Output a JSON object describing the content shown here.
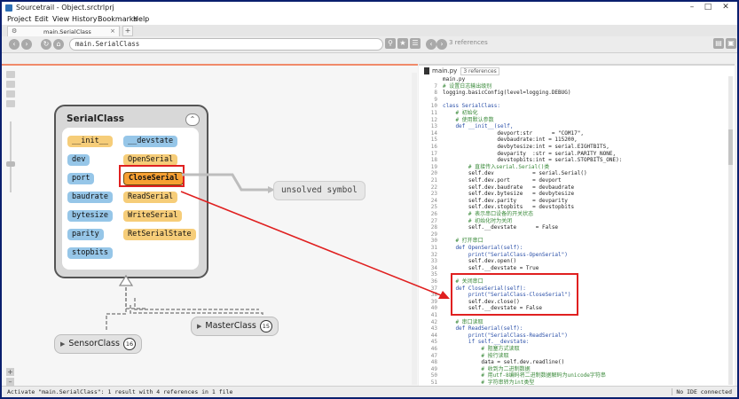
{
  "window": {
    "title": "Sourcetrail - Object.srctrlprj",
    "minimize": "–",
    "maximize": "□",
    "close": "✕"
  },
  "menu": [
    "Project",
    "Edit",
    "View",
    "History",
    "Bookmarks",
    "Help"
  ],
  "tab": {
    "label": "main.SerialClass",
    "close": "×",
    "add": "+"
  },
  "search": {
    "value": "main.SerialClass"
  },
  "code_toolbar": {
    "refs": "3 references"
  },
  "graph": {
    "class_name": "SerialClass",
    "members": [
      {
        "text": "__init__",
        "kind": "fn"
      },
      {
        "text": "__devstate",
        "kind": "var"
      },
      {
        "text": "dev",
        "kind": "var"
      },
      {
        "text": "OpenSerial",
        "kind": "fn"
      },
      {
        "text": "port",
        "kind": "var"
      },
      {
        "text": "CloseSerial",
        "kind": "fn"
      },
      {
        "text": "baudrate",
        "kind": "var"
      },
      {
        "text": "ReadSerial",
        "kind": "fn"
      },
      {
        "text": "bytesize",
        "kind": "var"
      },
      {
        "text": "WriteSerial",
        "kind": "fn"
      },
      {
        "text": "parity",
        "kind": "var"
      },
      {
        "text": "RetSerialState",
        "kind": "fn"
      },
      {
        "text": "stopbits",
        "kind": "var"
      }
    ],
    "unsolved": "unsolved symbol",
    "subclasses": [
      {
        "name": "SensorClass",
        "count": "16"
      },
      {
        "name": "MasterClass",
        "count": "15"
      }
    ],
    "colors": {
      "function": "#f6cd79",
      "variable": "#96c6e8",
      "selected": "#f6a033",
      "highlight": "#e02020"
    }
  },
  "code": {
    "file": "main.py",
    "refs_badge": "3 references",
    "lines": [
      {
        "n": "",
        "t": "main.py"
      },
      {
        "n": "7",
        "t": "# 设置日志输出级别",
        "c": "cm"
      },
      {
        "n": "8",
        "t": "logging.basicConfig(level=logging.DEBUG)"
      },
      {
        "n": "9",
        "t": ""
      },
      {
        "n": "10",
        "t": "class SerialClass:",
        "c": "cls"
      },
      {
        "n": "11",
        "t": "    # 初始化",
        "c": "cm"
      },
      {
        "n": "12",
        "t": "    # 使用默认参数",
        "c": "cm"
      },
      {
        "n": "13",
        "t": "    def __init__(self,"
      },
      {
        "n": "14",
        "t": "                 devport:str      = \"COM17\","
      },
      {
        "n": "15",
        "t": "                 devbaudrate:int = 115200,"
      },
      {
        "n": "16",
        "t": "                 devbytesize:int = serial.EIGHTBITS,"
      },
      {
        "n": "17",
        "t": "                 devparity  :str = serial.PARITY_NONE,"
      },
      {
        "n": "18",
        "t": "                 devstopbits:int = serial.STOPBITS_ONE):"
      },
      {
        "n": "19",
        "t": "        # 直接传入serial.Serial()类",
        "c": "cm"
      },
      {
        "n": "20",
        "t": "        self.dev            = serial.Serial()"
      },
      {
        "n": "21",
        "t": "        self.dev.port       = devport"
      },
      {
        "n": "22",
        "t": "        self.dev.baudrate   = devbaudrate"
      },
      {
        "n": "23",
        "t": "        self.dev.bytesize   = devbytesize"
      },
      {
        "n": "24",
        "t": "        self.dev.parity     = devparity"
      },
      {
        "n": "25",
        "t": "        self.dev.stopbits   = devstopbits"
      },
      {
        "n": "26",
        "t": "        # 表示串口设备的开关状态",
        "c": "cm"
      },
      {
        "n": "27",
        "t": "        # 初始化时为关闭",
        "c": "cm"
      },
      {
        "n": "28",
        "t": "        self.__devstate      = False"
      },
      {
        "n": "29",
        "t": ""
      },
      {
        "n": "30",
        "t": "    # 打开串口",
        "c": "cm"
      },
      {
        "n": "31",
        "t": "    def OpenSerial(self):"
      },
      {
        "n": "32",
        "t": "        print(\"SerialClass-OpenSerial\")"
      },
      {
        "n": "33",
        "t": "        self.dev.open()"
      },
      {
        "n": "34",
        "t": "        self.__devstate = True"
      },
      {
        "n": "35",
        "t": ""
      },
      {
        "n": "36",
        "t": "    # 关闭串口",
        "c": "cm"
      },
      {
        "n": "37",
        "t": "    def CloseSerial(self):"
      },
      {
        "n": "38",
        "t": "        print(\"SerialClass-CloseSerial\")"
      },
      {
        "n": "39",
        "t": "        self.dev.close()"
      },
      {
        "n": "40",
        "t": "        self.__devstate = False"
      },
      {
        "n": "41",
        "t": ""
      },
      {
        "n": "42",
        "t": "    # 串口读取",
        "c": "cm"
      },
      {
        "n": "43",
        "t": "    def ReadSerial(self):"
      },
      {
        "n": "44",
        "t": "        print(\"SerialClass-ReadSerial\")"
      },
      {
        "n": "45",
        "t": "        if self.__devstate:"
      },
      {
        "n": "46",
        "t": "            # 阻塞方式读取",
        "c": "cm"
      },
      {
        "n": "47",
        "t": "            # 按行读取",
        "c": "cm"
      },
      {
        "n": "48",
        "t": "            data = self.dev.readline()"
      },
      {
        "n": "49",
        "t": "            # 收到为二进制数据",
        "c": "cm"
      },
      {
        "n": "50",
        "t": "            # 用utf-8编码将二进制数据解码为unicode字符串",
        "c": "cm"
      },
      {
        "n": "51",
        "t": "            # 字符串转为int类型",
        "c": "cm"
      }
    ]
  },
  "status": {
    "left": "Activate \"main.SerialClass\": 1 result with 4 references in 1 file",
    "right": "No IDE connected"
  }
}
